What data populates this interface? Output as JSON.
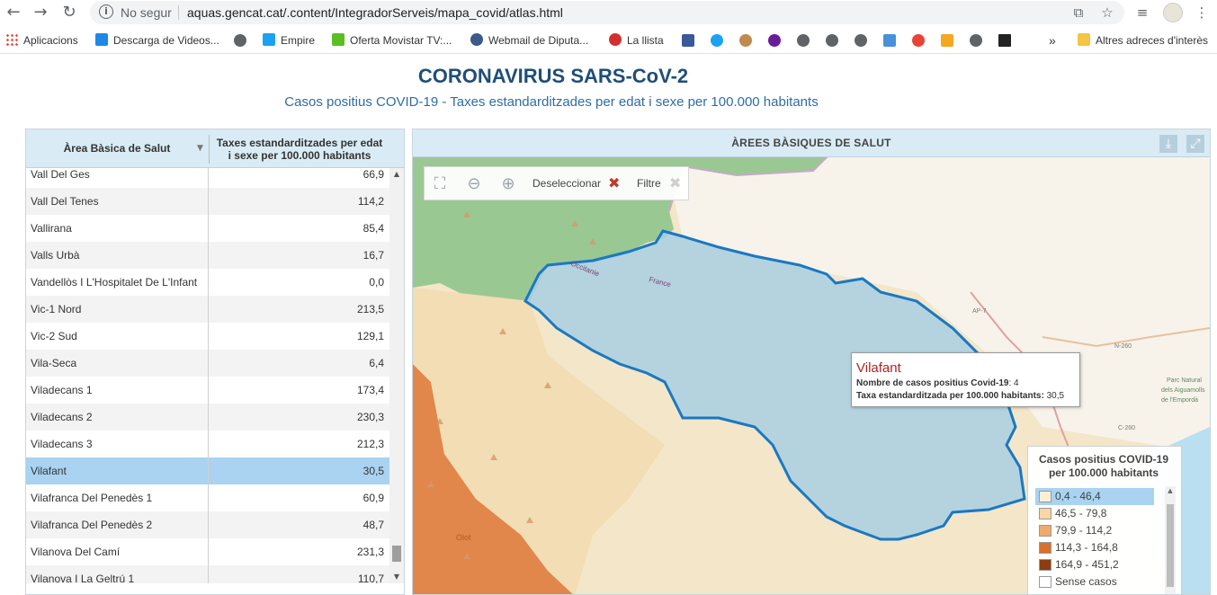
{
  "browser": {
    "insecure_label": "No segur",
    "url": "aquas.gencat.cat/.content/IntegradorServeis/mapa_covid/atlas.html"
  },
  "bookmarks": {
    "apps": "Aplicacions",
    "items": [
      {
        "label": "Descarga de Videos..."
      },
      {
        "label": "Empire"
      },
      {
        "label": "Oferta Movistar TV:..."
      },
      {
        "label": "Webmail de Diputa..."
      },
      {
        "label": "La llista"
      }
    ],
    "more": "»",
    "other": "Altres adreces d'interès"
  },
  "page": {
    "title": "CORONAVIRUS SARS-CoV-2",
    "subtitle": "Casos positius COVID-19 - Taxes estandarditzades per edat i sexe per 100.000 habitants"
  },
  "table": {
    "col1": "Àrea Bàsica de Salut",
    "col2_line1": "Taxes estandarditzades per edat",
    "col2_line2": "i sexe per 100.000 habitants",
    "rows": [
      {
        "name": "Vall Del Ges",
        "value": "66,9"
      },
      {
        "name": "Vall Del Tenes",
        "value": "114,2"
      },
      {
        "name": "Vallirana",
        "value": "85,4"
      },
      {
        "name": "Valls Urbà",
        "value": "16,7"
      },
      {
        "name": "Vandellòs I L'Hospitalet De L'Infant",
        "value": "0,0"
      },
      {
        "name": "Vic-1 Nord",
        "value": "213,5"
      },
      {
        "name": "Vic-2 Sud",
        "value": "129,1"
      },
      {
        "name": "Vila-Seca",
        "value": "6,4"
      },
      {
        "name": "Viladecans 1",
        "value": "173,4"
      },
      {
        "name": "Viladecans 2",
        "value": "230,3"
      },
      {
        "name": "Viladecans 3",
        "value": "212,3"
      },
      {
        "name": "Vilafant",
        "value": "30,5"
      },
      {
        "name": "Vilafranca Del Penedès 1",
        "value": "60,9"
      },
      {
        "name": "Vilafranca Del Penedès 2",
        "value": "48,7"
      },
      {
        "name": "Vilanova Del Camí",
        "value": "231,3"
      },
      {
        "name": "Vilanova I La Geltrú 1",
        "value": "110,7"
      }
    ],
    "selected": "Vilafant",
    "footer_partial": "Deseleccionar   Filtre"
  },
  "map": {
    "header": "ÀREES BÀSIQUES DE SALUT",
    "toolbar": {
      "deselect": "Deseleccionar",
      "filter": "Filtre"
    },
    "place_labels": {
      "occitania": "Occitanie",
      "france": "France",
      "olot": "Olot",
      "ap7": "AP-7",
      "n260": "N-260",
      "c260": "C-260",
      "park": [
        "Parc Natural",
        "dels Aiguamolls",
        "de l'Empordà"
      ]
    },
    "tooltip": {
      "title": "Vilafant",
      "cases_label": "Nombre de casos positius Covid-19",
      "cases_value": ": 4",
      "rate_label": "Taxa estandarditzada per 100.000 habitants:",
      "rate_value": " 30,5"
    },
    "legend": {
      "title_line1": "Casos positius COVID-19",
      "title_line2": "per 100.000 habitants",
      "items": [
        {
          "label": "0,4 - 46,4",
          "color": "#fbefd4"
        },
        {
          "label": "46,5 - 79,8",
          "color": "#f6d7a5"
        },
        {
          "label": "79,9 - 114,2",
          "color": "#efab6c"
        },
        {
          "label": "114,3 - 164,8",
          "color": "#d9702e"
        },
        {
          "label": "164,9 - 451,2",
          "color": "#8b3e0f"
        },
        {
          "label": "Sense casos",
          "color": "#ffffff"
        }
      ],
      "selected_index": 0
    },
    "colors": {
      "selected_fill": "#a8cfe2",
      "selected_stroke": "#1a78c2",
      "orange_region": "#e1874c",
      "green_region": "#9ac893"
    }
  }
}
